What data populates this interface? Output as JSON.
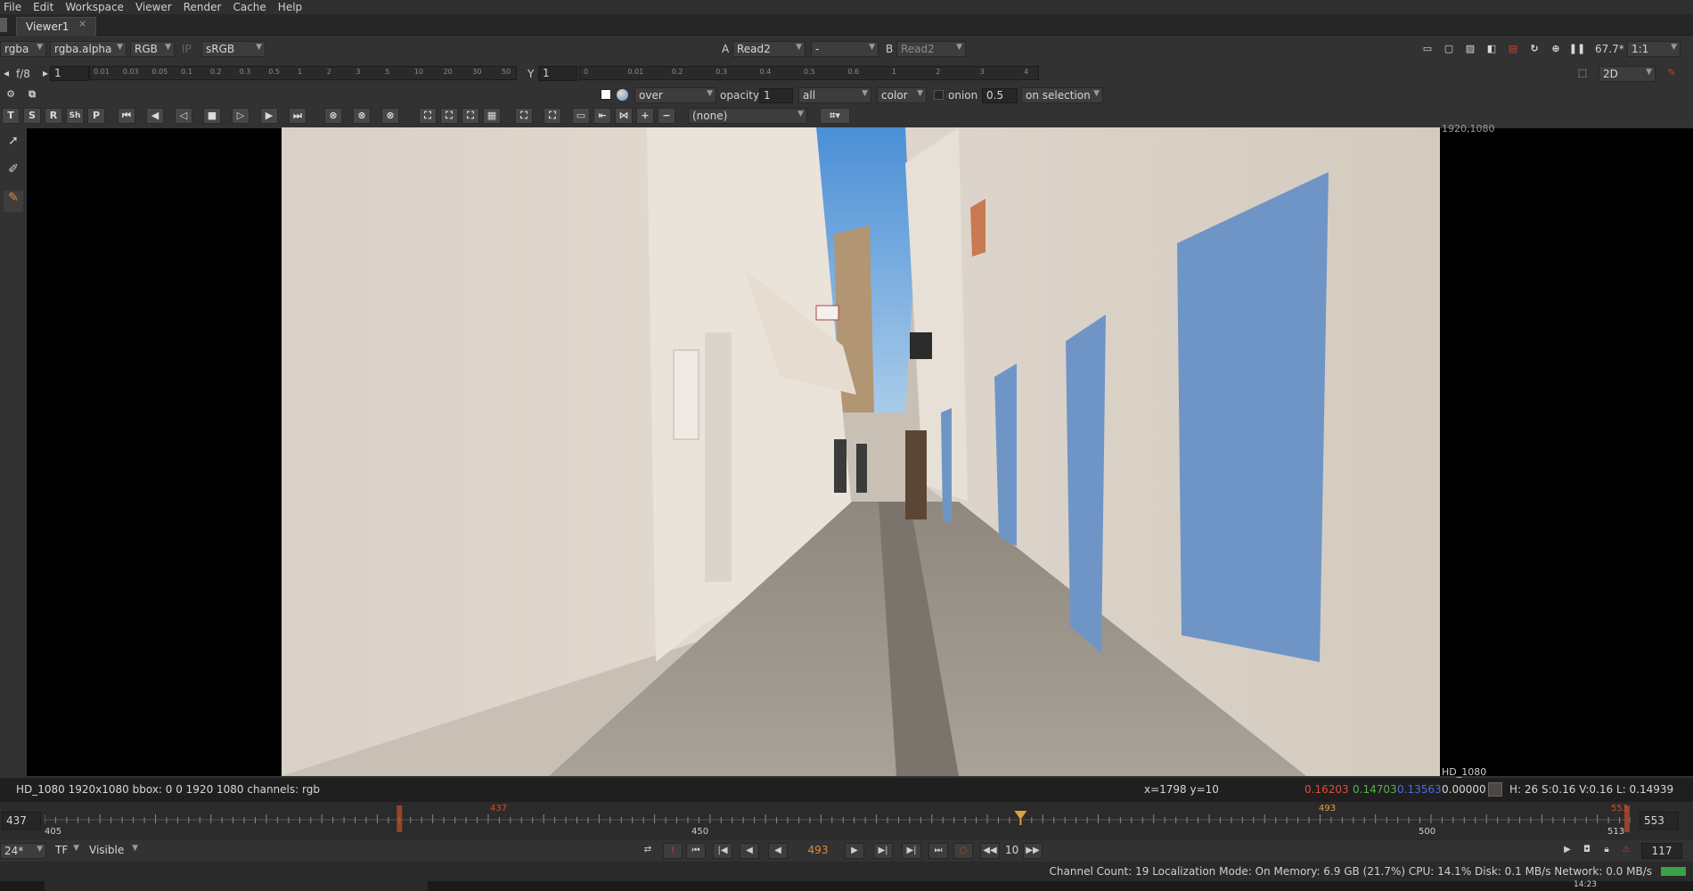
{
  "menu": [
    "File",
    "Edit",
    "Workspace",
    "Viewer",
    "Render",
    "Cache",
    "Help"
  ],
  "tab": {
    "label": "Viewer1",
    "close": "×"
  },
  "row1": {
    "channels": "rgba",
    "alpha": "rgba.alpha",
    "display": "RGB",
    "ip": "IP",
    "lut": "sRGB",
    "input_a_letter": "A",
    "input_a": "Read2",
    "op": "-",
    "input_b_letter": "B",
    "input_b": "Read2",
    "zoom": "67.7*",
    "ratio": "1:1"
  },
  "row2": {
    "fstop": "f/8",
    "gain_value": "1",
    "gain_ticks": [
      "0.01",
      "0.03",
      "0.05",
      "0.1",
      "0.2",
      "0.3",
      "0.5",
      "1",
      "2",
      "3",
      "5",
      "10",
      "20",
      "30",
      "50"
    ],
    "gamma_label": "Y",
    "gamma_value": "1",
    "gamma_ticks": [
      "0",
      "0.01",
      "0.2",
      "0.3",
      "0.4",
      "0.5",
      "0.6",
      "1",
      "2",
      "3",
      "4"
    ],
    "view_mode": "2D"
  },
  "row3": {
    "composite": "over",
    "opacity_label": "opacity",
    "opacity_value": "1",
    "layers": "all",
    "mode": "color",
    "onion_label": "onion",
    "onion_value": "0.5",
    "selection": "on selection"
  },
  "row4": {
    "buttons": [
      "T",
      "S",
      "R",
      "Sh",
      "P"
    ],
    "none": "(none)"
  },
  "viewer": {
    "format_top": "1920,1080",
    "format_bottom": "HD_1080"
  },
  "info": {
    "left": "HD_1080 1920x1080  bbox: 0 0 1920 1080 channels: rgb",
    "coords": "x=1798 y=10",
    "r": "0.16203",
    "g": "0.14703",
    "b": "0.13563",
    "a": "0.00000",
    "hsv": "H: 26 S:0.16 V:0.16  L: 0.14939",
    "colors": {
      "r": "#e04a3a",
      "g": "#58b048",
      "b": "#4a6ed8"
    }
  },
  "timeline": {
    "in_frame": "437",
    "out_frame": "553",
    "start_label": "405",
    "mid_label": "450",
    "right_label": "500",
    "end_label": "513",
    "in_marker": "437",
    "current_marker": "493",
    "out_marker": "553"
  },
  "playbar": {
    "fps": "24*",
    "tf": "TF",
    "visible": "Visible",
    "current_frame": "493",
    "step": "10",
    "frame_count": "117"
  },
  "status": {
    "text": "Channel Count: 19  Localization Mode: On  Memory: 6.9 GB (21.7%)  CPU: 14.1%  Disk: 0.1 MB/s  Network: 0.0 MB/s"
  },
  "taskbar": {
    "time": "14:23"
  }
}
